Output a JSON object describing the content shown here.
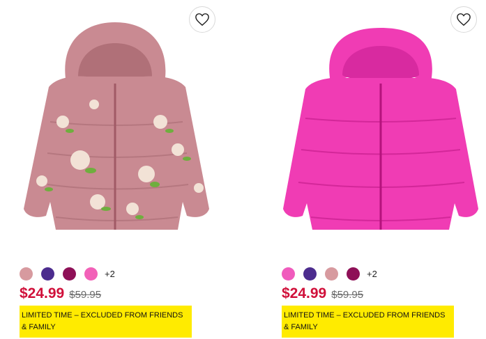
{
  "products": [
    {
      "image_alt": "Floral pink puffer jacket",
      "favorite_icon": "heart-icon",
      "swatches": [
        "#d79a9f",
        "#4c2c8e",
        "#8e1057",
        "#f261b8"
      ],
      "more_colors": "+2",
      "sale_price": "$24.99",
      "original_price": "$59.95",
      "promo": "LIMITED TIME – EXCLUDED FROM FRIENDS & FAMILY"
    },
    {
      "image_alt": "Hot pink puffer jacket",
      "favorite_icon": "heart-icon",
      "swatches": [
        "#f05bbd",
        "#4c2c8e",
        "#d79a9f",
        "#8e1057"
      ],
      "more_colors": "+2",
      "sale_price": "$24.99",
      "original_price": "$59.95",
      "promo": "LIMITED TIME – EXCLUDED FROM FRIENDS & FAMILY"
    }
  ],
  "colors": {
    "sale": "#d0103a",
    "promo_bg": "#ffeb00"
  }
}
